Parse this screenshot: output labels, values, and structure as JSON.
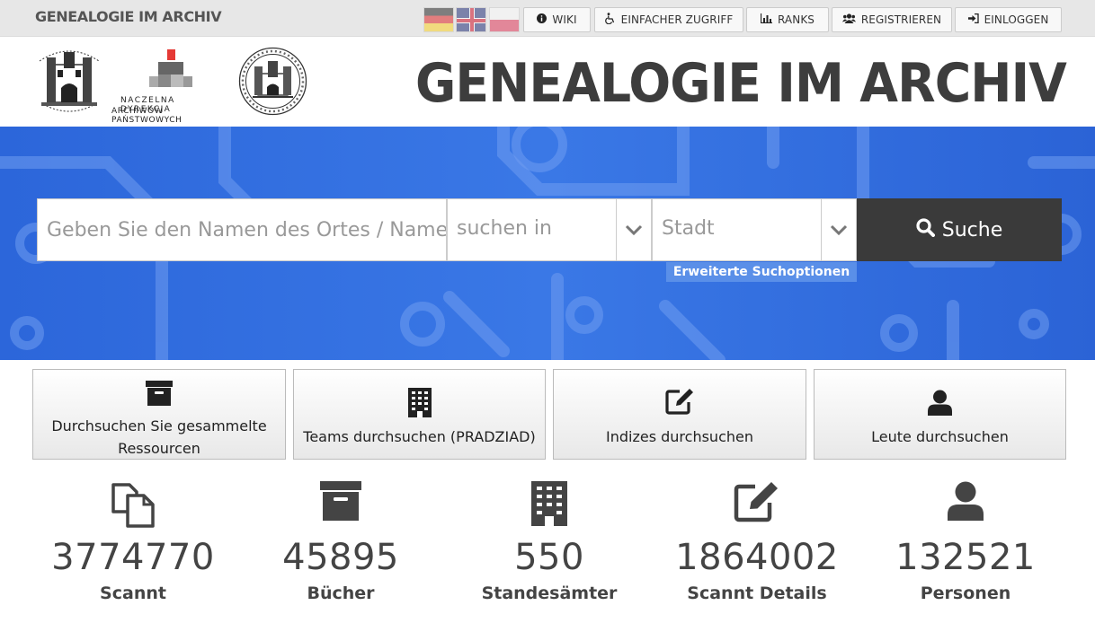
{
  "nav": {
    "brand": "GENEALOGIE IM ARCHIV",
    "flags": [
      "flag-de",
      "flag-uk",
      "flag-pl"
    ],
    "items": [
      {
        "label": "WIKI",
        "icon": "info-icon"
      },
      {
        "label": "EINFACHER ZUGRIFF",
        "icon": "wheelchair-icon"
      },
      {
        "label": "RANKS",
        "icon": "bar-chart-icon"
      },
      {
        "label": "REGISTRIEREN",
        "icon": "users-icon"
      },
      {
        "label": "EINLOGGEN",
        "icon": "sign-in-icon"
      }
    ]
  },
  "header": {
    "title": "GENEALOGIE IM ARCHIV",
    "logo2_text_1": "NACZELNA DYREKCJA",
    "logo2_text_2": "ARCHIWÓW PAŃSTWOWYCH"
  },
  "search": {
    "name_placeholder": "Geben Sie den Namen des Ortes / Namens",
    "in_placeholder": "suchen in",
    "city_placeholder": "Stadt",
    "button_label": "Suche",
    "advanced_label": "Erweiterte Suchoptionen"
  },
  "cards": [
    {
      "label": "Durchsuchen Sie gesammelte Ressourcen",
      "icon": "archive-box-icon"
    },
    {
      "label": "Teams durchsuchen (PRADZIAD)",
      "icon": "building-icon"
    },
    {
      "label": "Indizes durchsuchen",
      "icon": "edit-icon"
    },
    {
      "label": "Leute durchsuchen",
      "icon": "user-icon"
    }
  ],
  "stats": [
    {
      "value": "3774770",
      "label": "Scannt",
      "icon": "copy-icon"
    },
    {
      "value": "45895",
      "label": "Bücher",
      "icon": "archive-box-icon"
    },
    {
      "value": "550",
      "label": "Standesämter",
      "icon": "building-icon"
    },
    {
      "value": "1864002",
      "label": "Scannt Details",
      "icon": "edit-icon"
    },
    {
      "value": "132521",
      "label": "Personen",
      "icon": "user-icon"
    }
  ],
  "colors": {
    "hero": "#2f6de0",
    "button": "#3a3a3a",
    "advanced": "#5a8fe8"
  }
}
